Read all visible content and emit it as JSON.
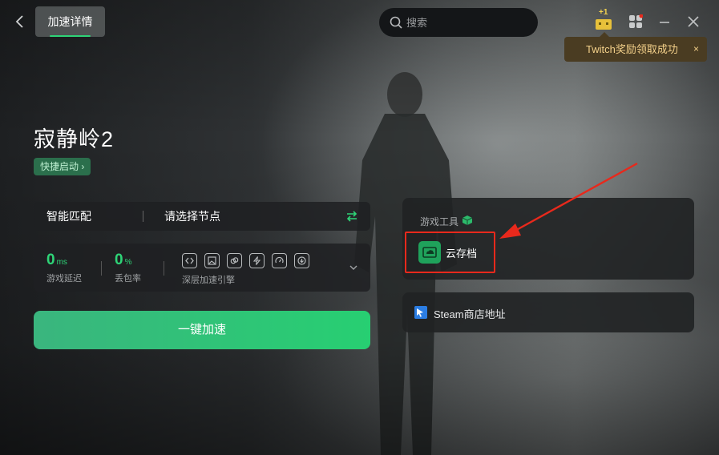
{
  "header": {
    "back_label": "",
    "active_tab": "加速详情",
    "search_placeholder": "搜索",
    "gift_badge": "+1"
  },
  "toast": {
    "message": "Twitch奖励领取成功",
    "close": "×"
  },
  "game": {
    "title": "寂静岭2",
    "quick_launch": "快捷启动 ›"
  },
  "node": {
    "mode": "智能匹配",
    "select_placeholder": "请选择节点"
  },
  "stats": {
    "latency_value": "0",
    "latency_unit": "ms",
    "latency_label": "游戏延迟",
    "loss_value": "0",
    "loss_unit": "%",
    "loss_label": "丢包率",
    "engine_label": "深层加速引擎",
    "engine_icons": [
      "code-icon",
      "image-icon",
      "link-icon",
      "bolt-icon",
      "gauge-icon",
      "download-icon"
    ]
  },
  "boost_button": "一键加速",
  "tools": {
    "header": "游戏工具",
    "cloud_save": "云存档"
  },
  "steam": {
    "label": "Steam商店地址"
  },
  "colors": {
    "accent": "#2ed477",
    "toast_text": "#f3d08a",
    "annotation": "#e8291c"
  }
}
